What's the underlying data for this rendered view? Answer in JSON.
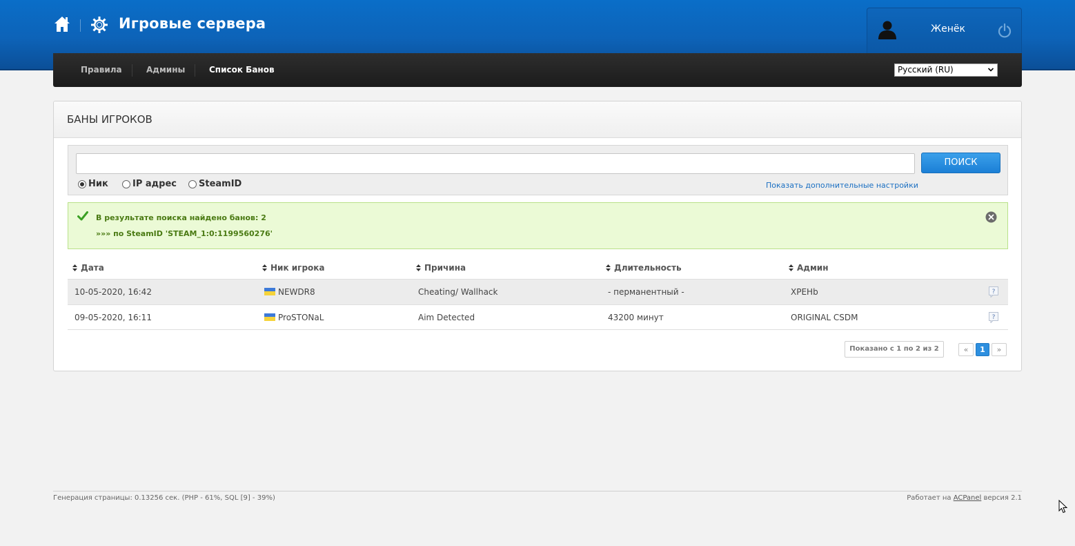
{
  "header": {
    "site_title": "Игровые сервера",
    "user_name": "Женёк",
    "home_icon": "home-icon",
    "gear_icon": "gear-icon",
    "user_icon": "user-icon",
    "power_icon": "power-icon"
  },
  "nav": {
    "items": [
      {
        "label": "Правила",
        "active": false
      },
      {
        "label": "Админы",
        "active": false
      },
      {
        "label": "Список Банов",
        "active": true
      }
    ],
    "language": "Русский (RU)"
  },
  "panel": {
    "title": "БАНЫ ИГРОКОВ",
    "search": {
      "value": "",
      "button_label": "ПОИСК",
      "radios": [
        {
          "label": "Ник",
          "checked": true
        },
        {
          "label": "IP адрес",
          "checked": false
        },
        {
          "label": "SteamID",
          "checked": false
        }
      ],
      "more_settings_link": "Показать дополнительные настройки"
    },
    "alert": {
      "line1": "В результате поиска найдено банов: 2",
      "line2": "»»» по SteamID 'STEAM_1:0:1199560276'"
    },
    "table": {
      "columns": [
        "Дата",
        "Ник игрока",
        "Причина",
        "Длительность",
        "Админ"
      ],
      "rows": [
        {
          "date": "10-05-2020, 16:42",
          "nick": "NEWDR8",
          "reason": "Cheating/ Wallhack",
          "duration": "- перманентный -",
          "admin": "XPEHb"
        },
        {
          "date": "09-05-2020, 16:11",
          "nick": "ProSTONaL",
          "reason": "Aim Detected",
          "duration": "43200 минут",
          "admin": "ORIGINAL CSDM"
        }
      ]
    },
    "pagination": {
      "info": "Показано с 1 по 2 из 2",
      "prev": "«",
      "current": "1",
      "next": "»"
    }
  },
  "footer": {
    "left": "Генерация страницы: 0.13256 сек. (PHP - 61%, SQL [9] - 39%)",
    "right_prefix": "Работает на",
    "right_link": "ACPanel",
    "right_suffix": "версия 2.1"
  },
  "colors": {
    "header_blue": "#0d63b8",
    "nav_dark": "#1f1f1f",
    "search_button": "#2a8fe0",
    "alert_bg": "#ebfad6",
    "alert_text": "#4a7a13"
  }
}
